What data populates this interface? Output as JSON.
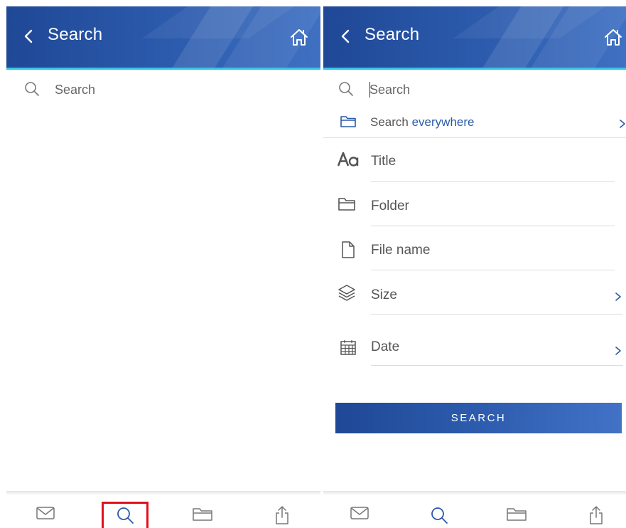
{
  "left_screen": {
    "header": {
      "title": "Search"
    },
    "search": {
      "placeholder": "Search"
    }
  },
  "right_screen": {
    "header": {
      "title": "Search"
    },
    "search": {
      "placeholder": "Search"
    },
    "search_scope": {
      "prefix": "Search ",
      "value": "everywhere"
    },
    "filters": [
      {
        "label": "Title",
        "icon": "text-aa-icon"
      },
      {
        "label": "Folder",
        "icon": "folder-icon"
      },
      {
        "label": "File name",
        "icon": "file-icon"
      },
      {
        "label": "Size",
        "icon": "layers-icon"
      },
      {
        "label": "Date",
        "icon": "calendar-icon"
      }
    ],
    "search_button_label": "SEARCH"
  },
  "bottom_nav": {
    "items": [
      {
        "icon": "mail-icon"
      },
      {
        "icon": "search-icon"
      },
      {
        "icon": "folder-icon"
      },
      {
        "icon": "share-icon"
      }
    ],
    "active_item": "search",
    "highlighted_item_left": "search"
  },
  "colors": {
    "header_dark": "#1f4896",
    "header_light": "#3f70c2",
    "header_underline": "#35c6e3",
    "accent": "#2a5aa8",
    "highlight": "#e3101e",
    "icon_gray": "#777777"
  }
}
